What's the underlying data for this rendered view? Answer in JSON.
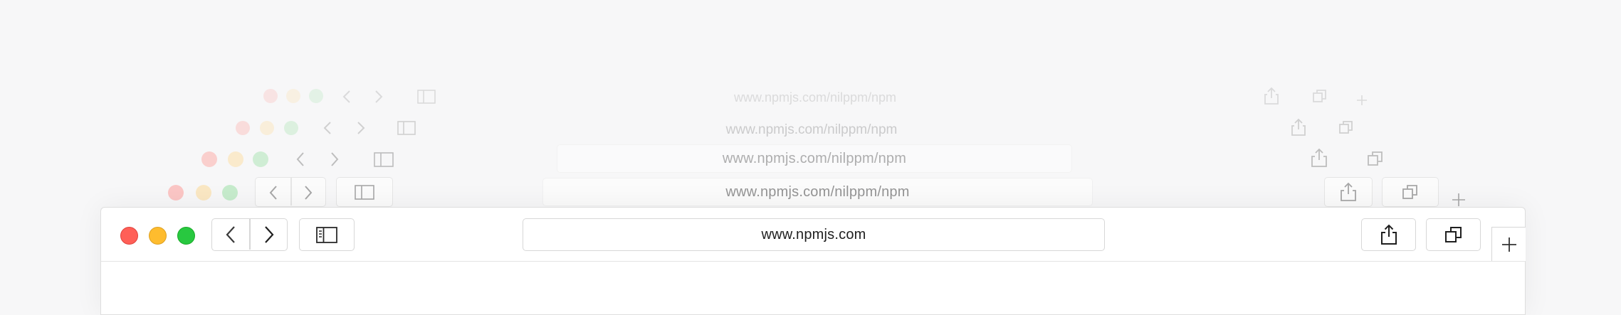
{
  "window": {
    "traffic_lights": {
      "close_color": "#ff5f57",
      "minimize_color": "#febc2e",
      "zoom_color": "#28c840"
    },
    "toolbar": {
      "back_icon": "chevron-left-icon",
      "forward_icon": "chevron-right-icon",
      "sidebar_icon": "sidebar-icon",
      "address": "www.npmjs.com",
      "share_icon": "share-icon",
      "tabs_icon": "tabs-overview-icon",
      "new_tab_icon": "plus-icon"
    }
  },
  "stacked_windows": [
    {
      "address": "www.npmjs.com/nilppm/npm"
    },
    {
      "address": "www.npmjs.com/nilppm/npm"
    },
    {
      "address": "www.npmjs.com/nilppm/npm"
    },
    {
      "address": "www.npmjs.com/nilppm/npm"
    }
  ]
}
